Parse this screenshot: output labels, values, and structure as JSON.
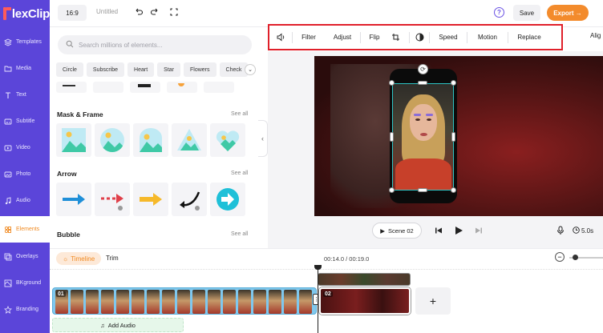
{
  "app": {
    "logo_text": "lexClip"
  },
  "sidebar": {
    "items": [
      {
        "label": "Templates",
        "icon": "layers-icon"
      },
      {
        "label": "Media",
        "icon": "folder-icon"
      },
      {
        "label": "Text",
        "icon": "text-icon"
      },
      {
        "label": "Subtitle",
        "icon": "subtitle-icon"
      },
      {
        "label": "Video",
        "icon": "video-icon"
      },
      {
        "label": "Photo",
        "icon": "photo-icon"
      },
      {
        "label": "Audio",
        "icon": "music-icon"
      },
      {
        "label": "Elements",
        "icon": "elements-icon",
        "active": true
      },
      {
        "label": "Overlays",
        "icon": "overlays-icon"
      },
      {
        "label": "BKground",
        "icon": "background-icon"
      },
      {
        "label": "Branding",
        "icon": "branding-icon"
      }
    ]
  },
  "topbar": {
    "ratio": "16:9",
    "title": "Untitled",
    "help": "?",
    "save_label": "Save",
    "export_label": "Export →"
  },
  "panel": {
    "search_placeholder": "Search millions of elements...",
    "chips": [
      "Circle",
      "Subscribe",
      "Heart",
      "Star",
      "Flowers",
      "Check"
    ],
    "mask_title": "Mask & Frame",
    "arrow_title": "Arrow",
    "bubble_title": "Bubble",
    "see_all": "See all"
  },
  "toolbar": {
    "filter": "Filter",
    "adjust": "Adjust",
    "flip": "Flip",
    "speed": "Speed",
    "motion": "Motion",
    "replace": "Replace",
    "align": "Alig"
  },
  "playback": {
    "scene_label": "Scene 02",
    "duration": "5.0s"
  },
  "timeline": {
    "tab_timeline": "Timeline",
    "tab_trim": "Trim",
    "timecode": "00:14.0 / 00:19.0",
    "clip1_number": "01",
    "clip2_number": "02",
    "add_scene": "+",
    "add_audio": "Add Audio"
  },
  "colors": {
    "sidebar": "#5b45d9",
    "accent": "#f38b2c",
    "highlight": "#e0202a"
  }
}
